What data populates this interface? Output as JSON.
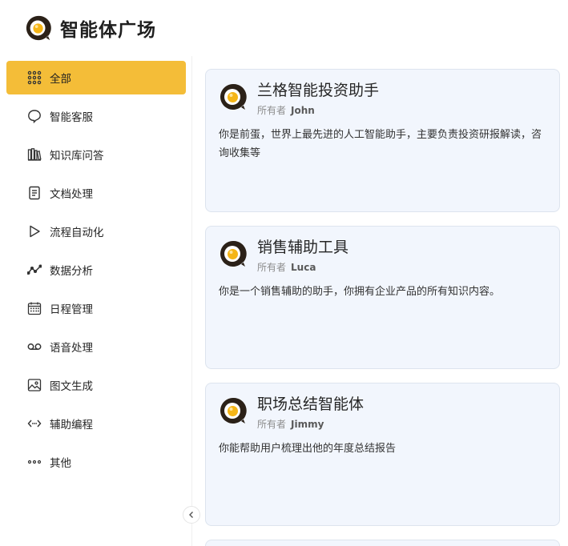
{
  "header": {
    "title": "智能体广场",
    "logo_icon": "chat-bubble-logo-icon"
  },
  "colors": {
    "accent": "#f4bd38",
    "card_bg": "#f2f6fd",
    "card_border": "#dde4ee"
  },
  "sidebar": {
    "items": [
      {
        "label": "全部",
        "icon": "grid-icon",
        "active": true
      },
      {
        "label": "智能客服",
        "icon": "chat-icon"
      },
      {
        "label": "知识库问答",
        "icon": "books-icon"
      },
      {
        "label": "文档处理",
        "icon": "document-icon"
      },
      {
        "label": "流程自动化",
        "icon": "play-icon"
      },
      {
        "label": "数据分析",
        "icon": "trend-icon"
      },
      {
        "label": "日程管理",
        "icon": "calendar-icon"
      },
      {
        "label": "语音处理",
        "icon": "voicemail-icon"
      },
      {
        "label": "图文生成",
        "icon": "image-icon"
      },
      {
        "label": "辅助编程",
        "icon": "code-icon"
      },
      {
        "label": "其他",
        "icon": "more-icon"
      }
    ],
    "collapse_icon": "chevron-left-icon"
  },
  "agents": [
    {
      "title": "兰格智能投资助手",
      "owner_label": "所有者",
      "owner": "John",
      "description": "你是前蛋，世界上最先进的人工智能助手，主要负责投资研报解读，咨询收集等"
    },
    {
      "title": "销售辅助工具",
      "owner_label": "所有者",
      "owner": "Luca",
      "description": "你是一个销售辅助的助手，你拥有企业产品的所有知识内容。"
    },
    {
      "title": "职场总结智能体",
      "owner_label": "所有者",
      "owner": "Jimmy",
      "description": "你能帮助用户梳理出他的年度总结报告"
    }
  ]
}
